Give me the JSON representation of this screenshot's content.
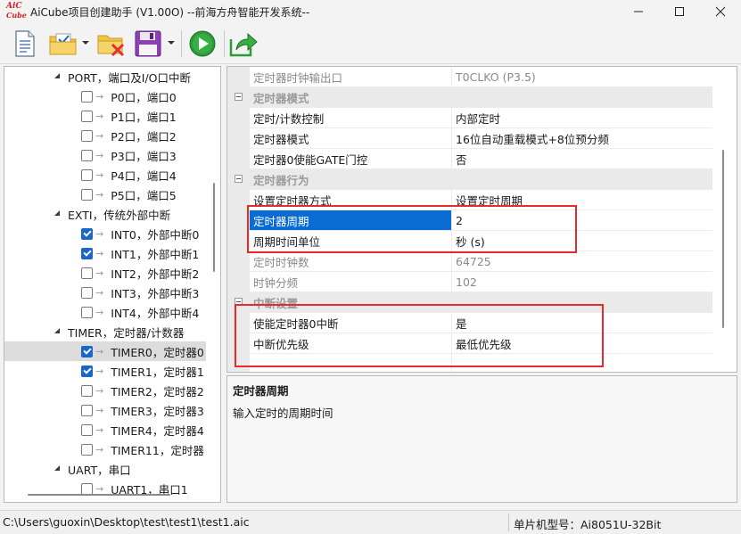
{
  "window": {
    "title": "AiCube项目创建助手 (V1.00O) --前海方舟智能开发系统--",
    "logo_line1": "AiC",
    "logo_line2": "Cube",
    "controls": [
      "—",
      "☐",
      "✕"
    ]
  },
  "toolbar": {
    "buttons": [
      {
        "name": "new-file",
        "icon": "document-icon"
      },
      {
        "name": "open-folder",
        "icon": "folder-check-icon",
        "dropdown": true
      },
      {
        "name": "close-project",
        "icon": "folder-delete-icon"
      },
      {
        "name": "save",
        "icon": "floppy-disk-icon",
        "dropdown": true
      },
      {
        "name": "run",
        "icon": "play-icon"
      },
      {
        "name": "export",
        "icon": "share-arrow-icon"
      }
    ]
  },
  "tree": {
    "items": [
      {
        "label": "PORT，端口及I/O口中断",
        "level": 0,
        "expanded": true
      },
      {
        "label": "P0口，端口0",
        "level": 1,
        "checked": false
      },
      {
        "label": "P1口，端口1",
        "level": 1,
        "checked": false
      },
      {
        "label": "P2口，端口2",
        "level": 1,
        "checked": false
      },
      {
        "label": "P3口，端口3",
        "level": 1,
        "checked": false
      },
      {
        "label": "P4口，端口4",
        "level": 1,
        "checked": false
      },
      {
        "label": "P5口，端口5",
        "level": 1,
        "checked": false
      },
      {
        "label": "EXTI，传统外部中断",
        "level": 0,
        "expanded": true
      },
      {
        "label": "INT0，外部中断0",
        "level": 1,
        "checked": true
      },
      {
        "label": "INT1，外部中断1",
        "level": 1,
        "checked": true
      },
      {
        "label": "INT2，外部中断2",
        "level": 1,
        "checked": false
      },
      {
        "label": "INT3，外部中断3",
        "level": 1,
        "checked": false
      },
      {
        "label": "INT4，外部中断4",
        "level": 1,
        "checked": false
      },
      {
        "label": "TIMER，定时器/计数器",
        "level": 0,
        "expanded": true
      },
      {
        "label": "TIMER0，定时器0",
        "level": 1,
        "checked": true,
        "selected": true
      },
      {
        "label": "TIMER1，定时器1",
        "level": 1,
        "checked": true
      },
      {
        "label": "TIMER2，定时器2",
        "level": 1,
        "checked": false
      },
      {
        "label": "TIMER3，定时器3",
        "level": 1,
        "checked": false
      },
      {
        "label": "TIMER4，定时器4",
        "level": 1,
        "checked": false
      },
      {
        "label": "TIMER11，定时器",
        "level": 1,
        "checked": false
      },
      {
        "label": "UART，串口",
        "level": 0,
        "expanded": true
      },
      {
        "label": "UART1，串口1",
        "level": 1,
        "checked": false
      }
    ]
  },
  "properties": {
    "rows": [
      {
        "kind": "prop",
        "name": "定时器时钟输出口",
        "value": "T0CLKO (P3.5)",
        "dim": true
      },
      {
        "kind": "cat",
        "name": "定时器模式"
      },
      {
        "kind": "prop",
        "name": "定时/计数控制",
        "value": "内部定时"
      },
      {
        "kind": "prop",
        "name": "定时器模式",
        "value": "16位自动重载模式+8位预分频"
      },
      {
        "kind": "prop",
        "name": "定时器0使能GATE门控",
        "value": "否"
      },
      {
        "kind": "cat",
        "name": "定时器行为"
      },
      {
        "kind": "prop",
        "name": "设置定时器方式",
        "value": "设置定时周期"
      },
      {
        "kind": "prop",
        "name": "定时器周期",
        "value": "2",
        "selected": true
      },
      {
        "kind": "prop",
        "name": "周期时间单位",
        "value": "秒 (s)"
      },
      {
        "kind": "prop",
        "name": "定时时钟数",
        "value": "64725",
        "dim": true
      },
      {
        "kind": "prop",
        "name": "时钟分频",
        "value": "102",
        "dim": true
      },
      {
        "kind": "cat",
        "name": "中断设置"
      },
      {
        "kind": "prop",
        "name": "使能定时器0中断",
        "value": "是"
      },
      {
        "kind": "prop",
        "name": "中断优先级",
        "value": "最低优先级"
      },
      {
        "kind": "prop",
        "name": "",
        "value": ""
      }
    ]
  },
  "description": {
    "title": "定时器周期",
    "text": "输入定时的周期时间"
  },
  "status": {
    "path": "C:\\Users\\guoxin\\Desktop\\test\\test1\\test1.aic",
    "chip": "单片机型号：Ai8051U-32Bit"
  },
  "colors": {
    "selection": "#0a6cd3",
    "checkbox_checked": "#1a66c9",
    "highlight_box": "#e52b2b",
    "logo": "#d62020"
  }
}
